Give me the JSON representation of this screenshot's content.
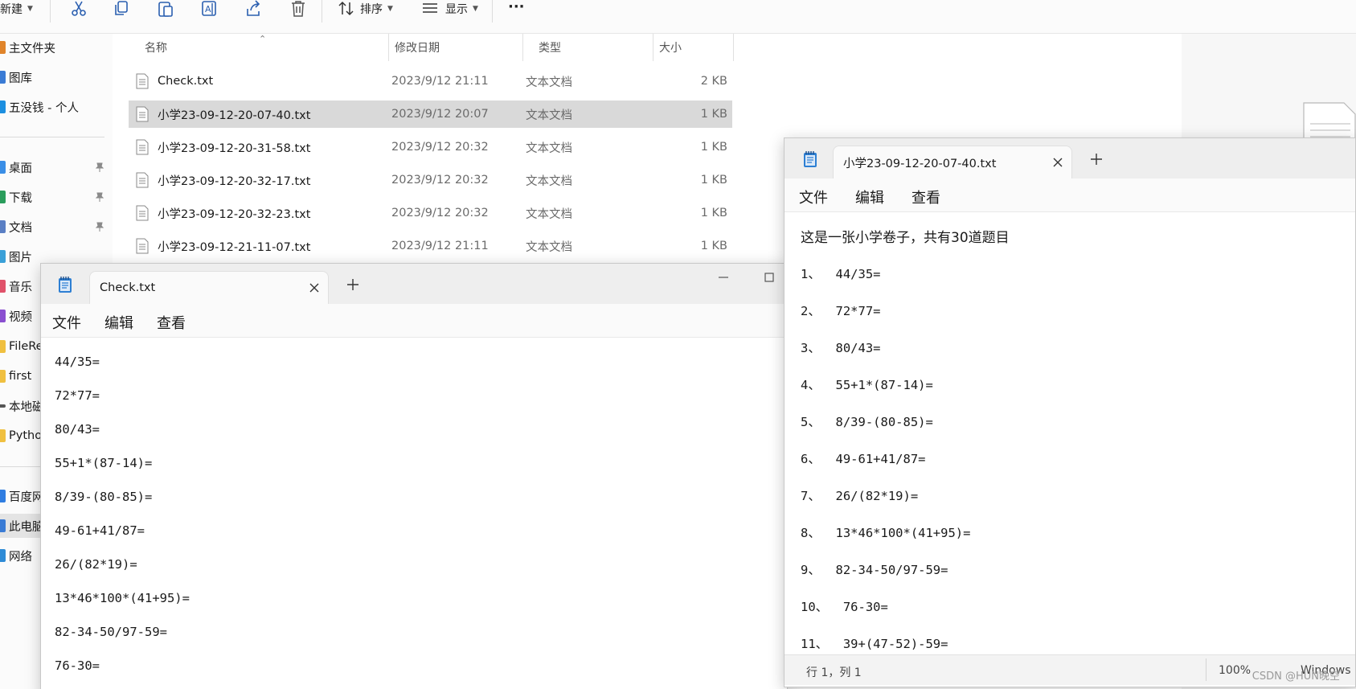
{
  "explorer": {
    "toolbar": {
      "new_label": "新建",
      "sort_label": "排序",
      "view_label": "显示",
      "more_label": "···",
      "icons": [
        "cut-icon",
        "copy-icon",
        "paste-icon",
        "rename-icon",
        "share-icon",
        "delete-icon",
        "sort-icon",
        "view-icon"
      ]
    },
    "sidebar": {
      "items": [
        {
          "label": "主文件夹",
          "color": "#e0842a"
        },
        {
          "label": "图库",
          "color": "#3a7bd5"
        },
        {
          "label": "五没钱 - 个人",
          "color": "#1c8fe0"
        },
        {
          "label": "桌面",
          "color": "#3a8ee6",
          "pinned": true
        },
        {
          "label": "下载",
          "color": "#2a9d5c",
          "pinned": true
        },
        {
          "label": "文档",
          "color": "#5a7fc4",
          "pinned": true
        },
        {
          "label": "图片",
          "color": "#3aa0d8"
        },
        {
          "label": "音乐",
          "color": "#e0526a"
        },
        {
          "label": "视频",
          "color": "#8a4fd0"
        },
        {
          "label": "FileRe",
          "color": "#f0c040"
        },
        {
          "label": "first",
          "color": "#f0c040"
        },
        {
          "label": "本地磁",
          "color": "#555555"
        },
        {
          "label": "Pytho",
          "color": "#f0c040"
        },
        {
          "label": "百度网",
          "color": "#2f7de1"
        },
        {
          "label": "此电脑",
          "color": "#3a7bd5",
          "selected": true
        },
        {
          "label": "网络",
          "color": "#2e8bd6"
        }
      ]
    },
    "columns": {
      "name": "名称",
      "date": "修改日期",
      "type": "类型",
      "size": "大小"
    },
    "files": [
      {
        "name": "Check.txt",
        "date": "2023/9/12 21:11",
        "type": "文本文档",
        "size": "2 KB"
      },
      {
        "name": "小学23-09-12-20-07-40.txt",
        "date": "2023/9/12 20:07",
        "type": "文本文档",
        "size": "1 KB",
        "selected": true
      },
      {
        "name": "小学23-09-12-20-31-58.txt",
        "date": "2023/9/12 20:32",
        "type": "文本文档",
        "size": "1 KB"
      },
      {
        "name": "小学23-09-12-20-32-17.txt",
        "date": "2023/9/12 20:32",
        "type": "文本文档",
        "size": "1 KB"
      },
      {
        "name": "小学23-09-12-20-32-23.txt",
        "date": "2023/9/12 20:32",
        "type": "文本文档",
        "size": "1 KB"
      },
      {
        "name": "小学23-09-12-21-11-07.txt",
        "date": "2023/9/12 21:11",
        "type": "文本文档",
        "size": "1 KB"
      }
    ]
  },
  "notepad_check": {
    "tab_title": "Check.txt",
    "menu": [
      "文件",
      "编辑",
      "查看"
    ],
    "lines": [
      "44/35=",
      "72*77=",
      "80/43=",
      "55+1*(87-14)=",
      "8/39-(80-85)=",
      "49-61+41/87=",
      "26/(82*19)=",
      "13*46*100*(41+95)=",
      "82-34-50/97-59=",
      "76-30="
    ]
  },
  "notepad_exam": {
    "tab_title": "小学23-09-12-20-07-40.txt",
    "menu": [
      "文件",
      "编辑",
      "查看"
    ],
    "heading": "这是一张小学卷子，共有30道题目",
    "lines": [
      "1、  44/35=",
      "2、  72*77=",
      "3、  80/43=",
      "4、  55+1*(87-14)=",
      "5、  8/39-(80-85)=",
      "6、  49-61+41/87=",
      "7、  26/(82*19)=",
      "8、  13*46*100*(41+95)=",
      "9、  82-34-50/97-59=",
      "10、  76-30=",
      "11、  39+(47-52)-59="
    ],
    "status": {
      "position": "行 1，列 1",
      "zoom": "100%",
      "line_ending": "Windows"
    }
  },
  "watermark": "CSDN @HUN晚空"
}
